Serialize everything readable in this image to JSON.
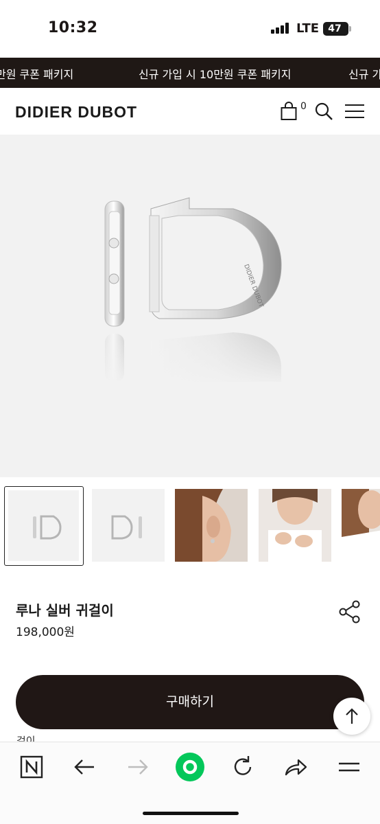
{
  "status_bar": {
    "time": "10:32",
    "network": "LTE",
    "battery": "47"
  },
  "promo_banner": {
    "messages": [
      "만원 쿠폰 패키지",
      "신규 가입 시 10만원 쿠폰 패키지",
      "신규 가"
    ]
  },
  "header": {
    "logo": "DIDIER DUBOT",
    "cart_count": "0",
    "icons": [
      "shopping-bag-icon",
      "search-icon",
      "hamburger-menu-icon"
    ]
  },
  "gallery": {
    "main_image": "silver hoop earrings product photo",
    "thumbnails": [
      "earrings-front",
      "earrings-side",
      "model-ear",
      "model-hands",
      "model-portrait"
    ],
    "selected_index": 0
  },
  "product": {
    "name": "루나 실버 귀걸이",
    "price": "198,000원"
  },
  "peek": {
    "line": "걸이"
  },
  "actions": {
    "buy_label": "구매하기"
  },
  "browser_bar": {
    "icons": [
      "naver-n-icon",
      "back-arrow-icon",
      "forward-arrow-icon",
      "green-home-icon",
      "reload-icon",
      "share-arrow-icon",
      "menu-icon"
    ]
  },
  "colors": {
    "banner_bg": "#1f1815",
    "buy_button_bg": "#201715",
    "naver_green": "#03c75a",
    "image_bg": "#f2f2f2"
  }
}
